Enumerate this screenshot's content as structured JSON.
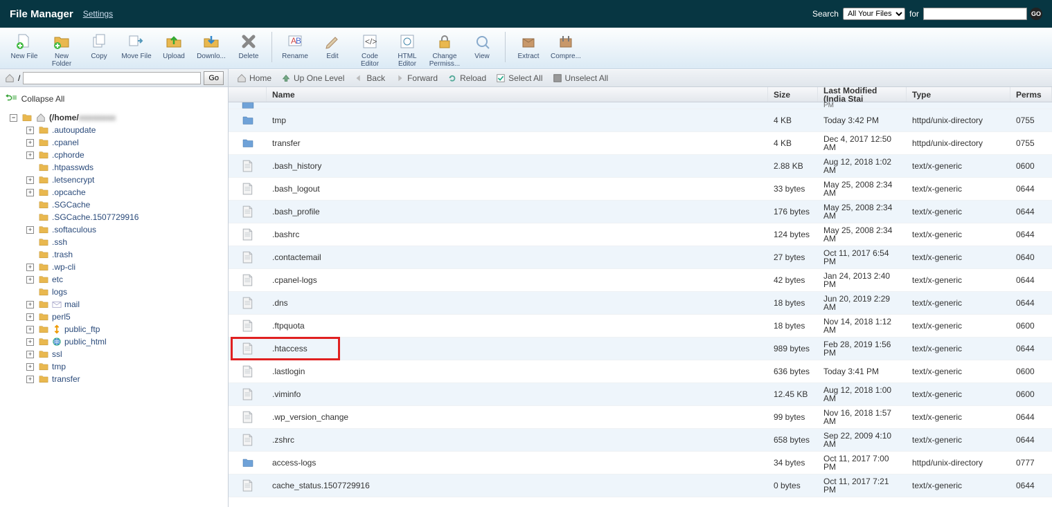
{
  "header": {
    "title": "File Manager",
    "settings": "Settings",
    "search_label": "Search",
    "search_scope": "All Your Files",
    "for_label": "for",
    "search_value": "",
    "go": "GO"
  },
  "toolbar": [
    {
      "id": "new-file",
      "label": "New File"
    },
    {
      "id": "new-folder",
      "label": "New",
      "label2": "Folder"
    },
    {
      "id": "copy",
      "label": "Copy"
    },
    {
      "id": "move",
      "label": "Move File"
    },
    {
      "id": "upload",
      "label": "Upload"
    },
    {
      "id": "download",
      "label": "Downlo..."
    },
    {
      "id": "delete",
      "label": "Delete"
    },
    {
      "sep": true
    },
    {
      "id": "rename",
      "label": "Rename"
    },
    {
      "id": "edit",
      "label": "Edit"
    },
    {
      "id": "code-editor",
      "label": "Code",
      "label2": "Editor"
    },
    {
      "id": "html-editor",
      "label": "HTML",
      "label2": "Editor"
    },
    {
      "id": "change-perms",
      "label": "Change",
      "label2": "Permiss..."
    },
    {
      "id": "view",
      "label": "View"
    },
    {
      "sep": true
    },
    {
      "id": "extract",
      "label": "Extract"
    },
    {
      "id": "compress",
      "label": "Compre..."
    }
  ],
  "pathbar": {
    "prefix": "/",
    "value": "",
    "go": "Go"
  },
  "nav": {
    "home": "Home",
    "up": "Up One Level",
    "back": "Back",
    "forward": "Forward",
    "reload": "Reload",
    "select_all": "Select All",
    "unselect_all": "Unselect All"
  },
  "collapse_all": "Collapse All",
  "tree_root": {
    "label": "(/home/",
    "blurred": "xxxxxxxx"
  },
  "tree": [
    {
      "exp": true,
      "label": ".autoupdate"
    },
    {
      "exp": true,
      "label": ".cpanel"
    },
    {
      "exp": true,
      "label": ".cphorde"
    },
    {
      "exp": false,
      "label": ".htpasswds"
    },
    {
      "exp": true,
      "label": ".letsencrypt"
    },
    {
      "exp": true,
      "label": ".opcache"
    },
    {
      "exp": false,
      "label": ".SGCache"
    },
    {
      "exp": false,
      "label": ".SGCache.1507729916"
    },
    {
      "exp": true,
      "label": ".softaculous"
    },
    {
      "exp": false,
      "label": ".ssh"
    },
    {
      "exp": false,
      "label": ".trash"
    },
    {
      "exp": true,
      "label": ".wp-cli"
    },
    {
      "exp": true,
      "label": "etc"
    },
    {
      "exp": false,
      "label": "logs"
    },
    {
      "exp": true,
      "label": "mail",
      "special": "envelope"
    },
    {
      "exp": true,
      "label": "perl5"
    },
    {
      "exp": true,
      "label": "public_ftp",
      "special": "ftp"
    },
    {
      "exp": true,
      "label": "public_html",
      "special": "globe"
    },
    {
      "exp": true,
      "label": "ssl"
    },
    {
      "exp": true,
      "label": "tmp"
    },
    {
      "exp": true,
      "label": "transfer"
    }
  ],
  "columns": {
    "name": "Name",
    "size": "Size",
    "modified": "Last Modified (India Stai",
    "type": "Type",
    "perms": "Perms"
  },
  "rows": [
    {
      "icon": "folder-blue",
      "name": "tmp",
      "size": "4 KB",
      "mod": "Today 3:42 PM",
      "type": "httpd/unix-directory",
      "perms": "0755"
    },
    {
      "icon": "folder-blue",
      "name": "transfer",
      "size": "4 KB",
      "mod": "Dec 4, 2017 12:50 AM",
      "type": "httpd/unix-directory",
      "perms": "0755"
    },
    {
      "icon": "file",
      "name": ".bash_history",
      "size": "2.88 KB",
      "mod": "Aug 12, 2018 1:02 AM",
      "type": "text/x-generic",
      "perms": "0600"
    },
    {
      "icon": "file",
      "name": ".bash_logout",
      "size": "33 bytes",
      "mod": "May 25, 2008 2:34 AM",
      "type": "text/x-generic",
      "perms": "0644"
    },
    {
      "icon": "file",
      "name": ".bash_profile",
      "size": "176 bytes",
      "mod": "May 25, 2008 2:34 AM",
      "type": "text/x-generic",
      "perms": "0644"
    },
    {
      "icon": "file",
      "name": ".bashrc",
      "size": "124 bytes",
      "mod": "May 25, 2008 2:34 AM",
      "type": "text/x-generic",
      "perms": "0644"
    },
    {
      "icon": "file",
      "name": ".contactemail",
      "size": "27 bytes",
      "mod": "Oct 11, 2017 6:54 PM",
      "type": "text/x-generic",
      "perms": "0640"
    },
    {
      "icon": "file",
      "name": ".cpanel-logs",
      "size": "42 bytes",
      "mod": "Jan 24, 2013 2:40 PM",
      "type": "text/x-generic",
      "perms": "0644"
    },
    {
      "icon": "file",
      "name": ".dns",
      "size": "18 bytes",
      "mod": "Jun 20, 2019 2:29 AM",
      "type": "text/x-generic",
      "perms": "0644"
    },
    {
      "icon": "file",
      "name": ".ftpquota",
      "size": "18 bytes",
      "mod": "Nov 14, 2018 1:12 AM",
      "type": "text/x-generic",
      "perms": "0600"
    },
    {
      "icon": "file",
      "name": ".htaccess",
      "size": "989 bytes",
      "mod": "Feb 28, 2019 1:56 PM",
      "type": "text/x-generic",
      "perms": "0644",
      "highlight": true
    },
    {
      "icon": "file",
      "name": ".lastlogin",
      "size": "636 bytes",
      "mod": "Today 3:41 PM",
      "type": "text/x-generic",
      "perms": "0600"
    },
    {
      "icon": "file",
      "name": ".viminfo",
      "size": "12.45 KB",
      "mod": "Aug 12, 2018 1:00 AM",
      "type": "text/x-generic",
      "perms": "0600"
    },
    {
      "icon": "file",
      "name": ".wp_version_change",
      "size": "99 bytes",
      "mod": "Nov 16, 2018 1:57 AM",
      "type": "text/x-generic",
      "perms": "0644"
    },
    {
      "icon": "file",
      "name": ".zshrc",
      "size": "658 bytes",
      "mod": "Sep 22, 2009 4:10 AM",
      "type": "text/x-generic",
      "perms": "0644"
    },
    {
      "icon": "folder-blue",
      "name": "access-logs",
      "size": "34 bytes",
      "mod": "Oct 11, 2017 7:00 PM",
      "type": "httpd/unix-directory",
      "perms": "0777"
    },
    {
      "icon": "file",
      "name": "cache_status.1507729916",
      "size": "0 bytes",
      "mod": "Oct 11, 2017 7:21 PM",
      "type": "text/x-generic",
      "perms": "0644"
    }
  ]
}
